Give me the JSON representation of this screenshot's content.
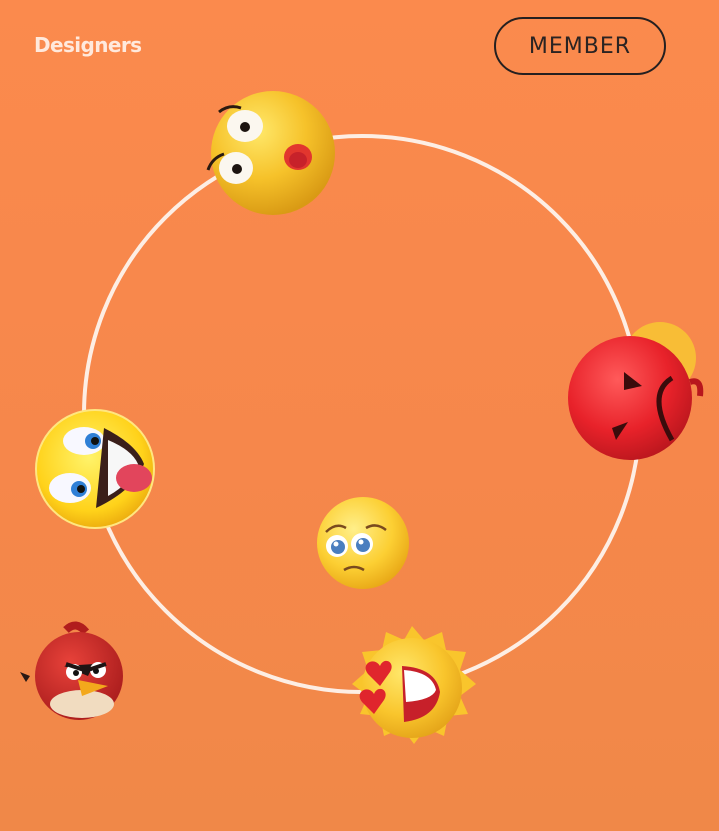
{
  "header": {
    "brand": "Designers",
    "member_button": "MEMBER"
  },
  "colors": {
    "background": "#f88a4c",
    "ring": "#fdeee4",
    "button_border": "#252020"
  },
  "orbit": {
    "emojis": [
      {
        "name": "surprised-emoji-icon"
      },
      {
        "name": "angry-red-emoji-icon"
      },
      {
        "name": "laughing-emoji-icon"
      },
      {
        "name": "pleading-emoji-icon"
      },
      {
        "name": "heart-eyes-sun-emoji-icon"
      }
    ]
  },
  "extras": {
    "bird": "angry-bird-icon"
  }
}
